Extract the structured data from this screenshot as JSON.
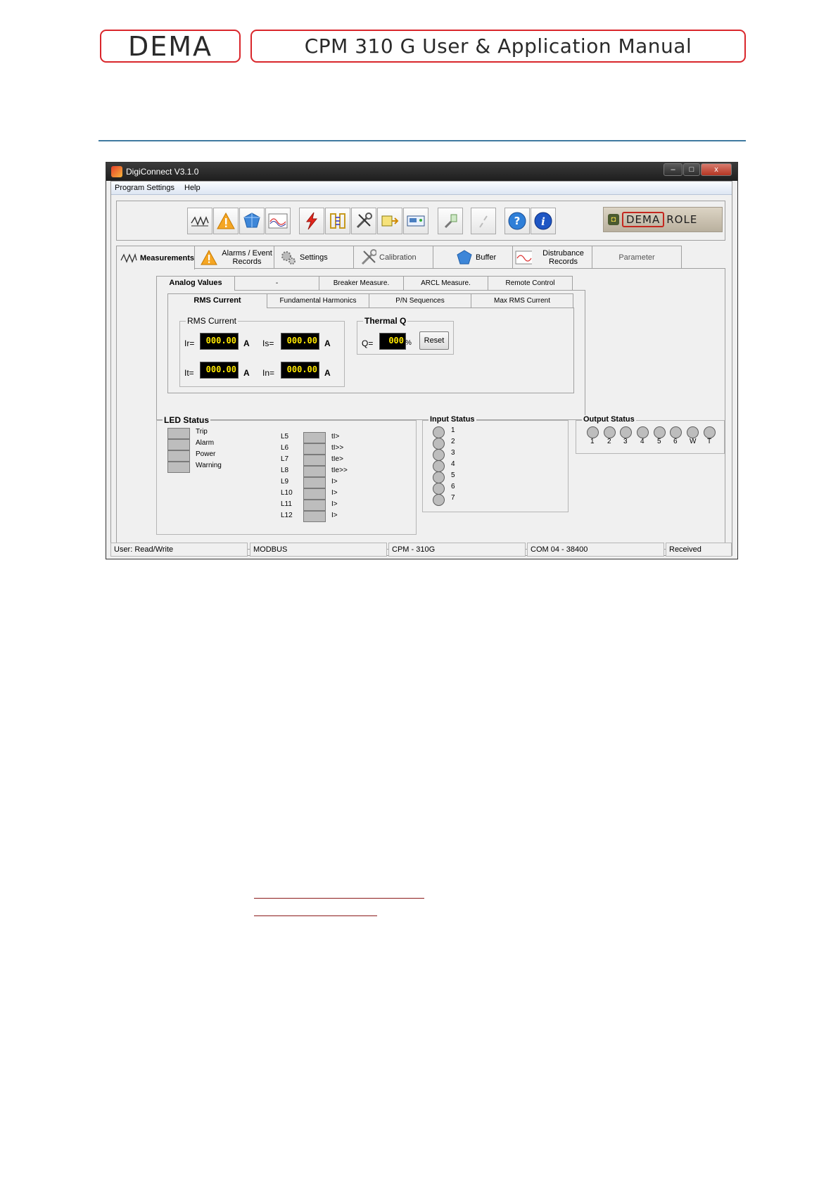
{
  "header": {
    "brand": "DEMA",
    "title": "CPM 310 G User & Application Manual"
  },
  "window": {
    "title": "DigiConnect V3.1.0",
    "controls": [
      "–",
      "□",
      "x"
    ],
    "menu": [
      "Program Settings",
      "Help"
    ],
    "logo": {
      "dema": "DEMA",
      "role": "ROLE"
    },
    "tabs": [
      {
        "label": "Measurements",
        "icon": "waveform-icon"
      },
      {
        "label": "Alarms / Event Records",
        "icon": "warning-icon"
      },
      {
        "label": "Settings",
        "icon": "gears-icon"
      },
      {
        "label": "Calibration",
        "icon": "tools-icon"
      },
      {
        "label": "Buffer",
        "icon": "buffer-icon"
      },
      {
        "label": "Distrubance Records",
        "icon": "chart-icon"
      },
      {
        "label": "Parameter",
        "icon": ""
      }
    ],
    "subtabs": [
      "Analog Values",
      "-",
      "Breaker Measure.",
      "ARCL Measure.",
      "Remote Control"
    ],
    "subsubtabs": [
      "RMS Current",
      "Fundamental Harmonics",
      "P/N Sequences",
      "Max RMS Current"
    ],
    "rms": {
      "title": "RMS Current",
      "ir_label": "Ir=",
      "ir": "000.00",
      "is_label": "Is=",
      "is": "000.00",
      "it_label": "It=",
      "it": "000.00",
      "in_label": "In=",
      "in": "000.00",
      "unit": "A"
    },
    "thermal": {
      "title": "Thermal Q",
      "q_label": "Q=",
      "q": "000",
      "unit": "%",
      "reset": "Reset"
    },
    "led_status": {
      "title": "LED Status",
      "left": [
        "Trip",
        "Alarm",
        "Power",
        "Warning"
      ],
      "right": [
        {
          "id": "L5",
          "label": "tI>"
        },
        {
          "id": "L6",
          "label": "tI>>"
        },
        {
          "id": "L7",
          "label": "tIe>"
        },
        {
          "id": "L8",
          "label": "tIe>>"
        },
        {
          "id": "L9",
          "label": "I>"
        },
        {
          "id": "L10",
          "label": "I>"
        },
        {
          "id": "L11",
          "label": "I>"
        },
        {
          "id": "L12",
          "label": "I>"
        }
      ]
    },
    "input_status": {
      "title": "Input Status",
      "items": [
        "1",
        "2",
        "3",
        "4",
        "5",
        "6",
        "7"
      ]
    },
    "output_status": {
      "title": "Output Status",
      "items": [
        "1",
        "2",
        "3",
        "4",
        "5",
        "6",
        "W",
        "T"
      ]
    },
    "statusbar": [
      "User: Read/Write",
      "MODBUS",
      "CPM - 310G",
      "COM 04 - 38400",
      "Received"
    ]
  }
}
